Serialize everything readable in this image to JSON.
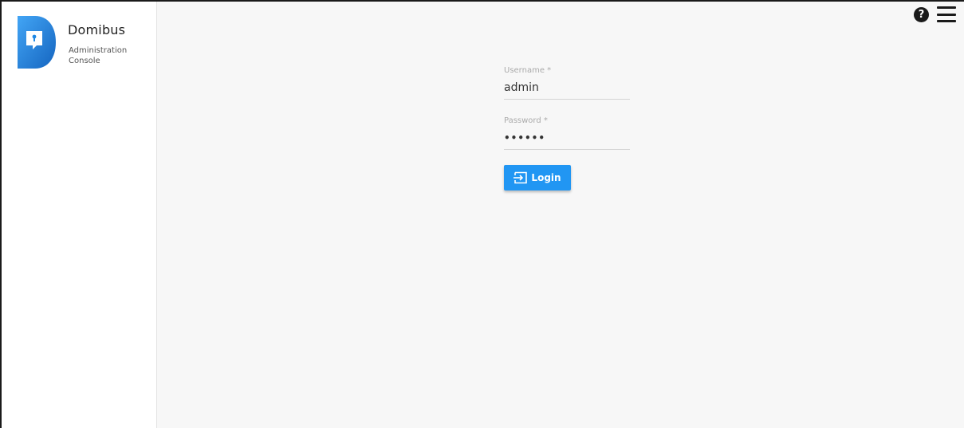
{
  "brand": {
    "title": "Domibus",
    "subtitle": "Administration Console",
    "logo_icon": "domibus-keyhole-logo",
    "logo_color": "#1e88e5"
  },
  "topbar": {
    "help_icon": "help-icon",
    "help_glyph": "?",
    "menu_icon": "hamburger-menu-icon"
  },
  "login": {
    "username_label": "Username *",
    "username_value": "admin",
    "password_label": "Password *",
    "password_value": "••••••",
    "login_label": "Login",
    "login_icon": "login-enter-icon",
    "button_color": "#2196f3"
  }
}
